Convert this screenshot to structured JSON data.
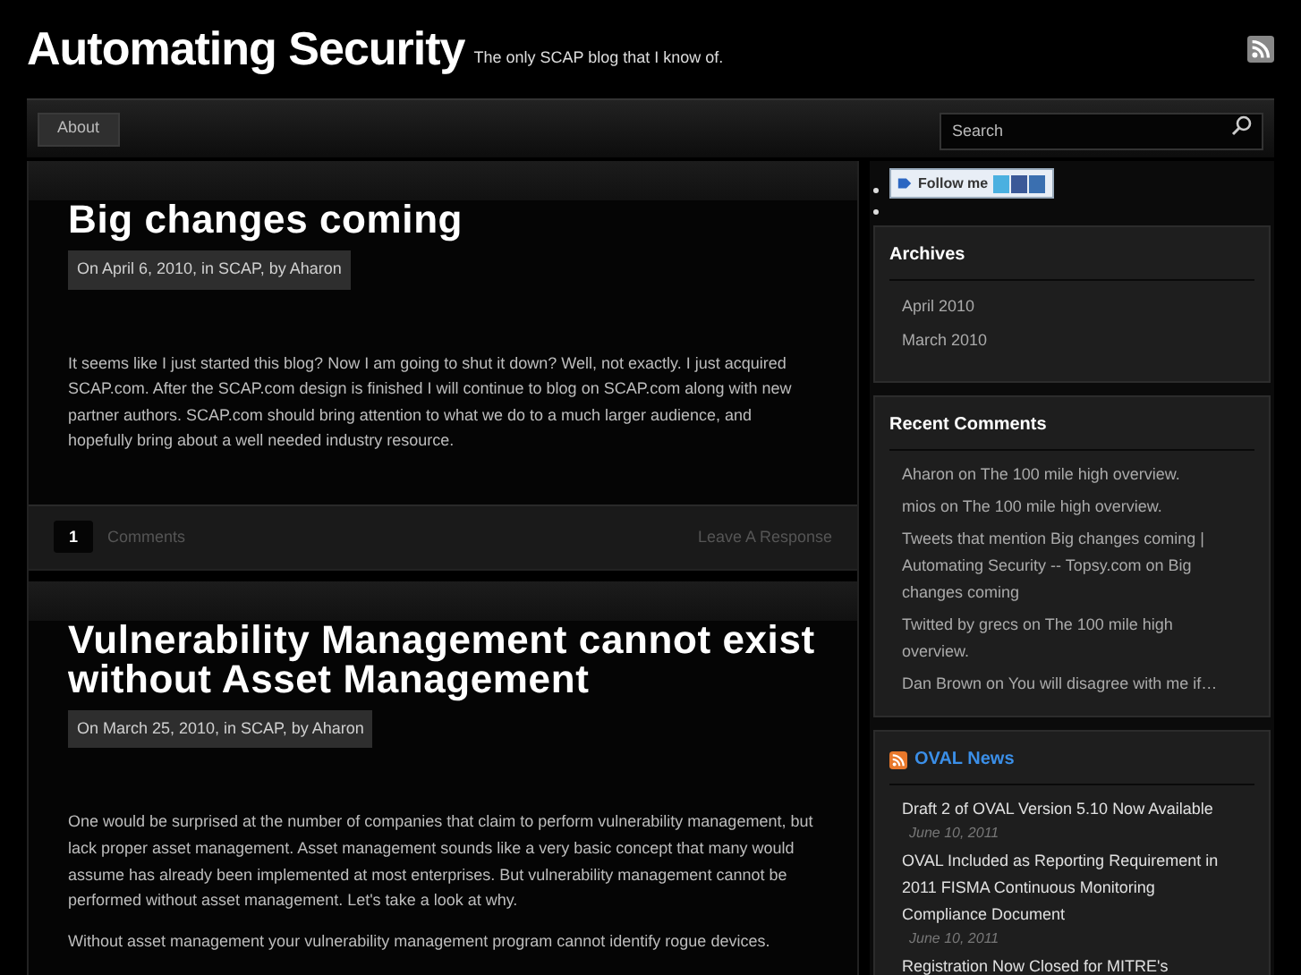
{
  "header": {
    "title": "Automating Security",
    "tagline": "The only SCAP blog that I know of."
  },
  "nav": {
    "items": [
      {
        "label": "About",
        "selected": false
      }
    ],
    "search": {
      "placeholder": "Search"
    }
  },
  "posts": [
    {
      "title": "Big changes coming",
      "meta": "On April 6, 2010, in SCAP, by Aharon",
      "paragraphs": [
        "It seems like I just started this blog? Now I am going to shut it down? Well, not exactly. I just acquired SCAP.com. After the SCAP.com design is finished I will continue to blog on SCAP.com along with new partner authors. SCAP.com should bring attention to what we do to a much larger audience, and hopefully bring about a well needed industry resource."
      ],
      "comment_count": "1",
      "comments_label": "Comments",
      "response_link": "Leave A Response"
    },
    {
      "title": "Vulnerability Management cannot exist without Asset Management",
      "meta": "On March 25, 2010, in SCAP, by Aharon",
      "paragraphs": [
        "One would be surprised at the number of companies that claim to perform vulnerability management, but lack proper asset management. Asset management sounds like a very basic concept that many would assume has already been implemented at most enterprises. But vulnerability management cannot be performed without asset management. Let's take a look at why.",
        "Without asset management your vulnerability management program cannot identify rogue devices."
      ]
    }
  ],
  "sidebar": {
    "follow_badge": "Follow me",
    "archives": {
      "title": "Archives",
      "items": [
        "April 2010",
        "March 2010"
      ]
    },
    "recent_comments": {
      "title": "Recent Comments",
      "items": [
        "Aharon on The 100 mile high overview.",
        "mios on The 100 mile high overview.",
        "Tweets that mention Big changes coming | Automating Security -- Topsy.com on Big changes coming",
        "Twitted by grecs on The 100 mile high overview.",
        "Dan Brown on You will disagree with me if…"
      ]
    },
    "oval_news": {
      "title": "OVAL News",
      "items": [
        {
          "title": "Draft 2 of OVAL Version 5.10 Now Available",
          "date": "June 10, 2011"
        },
        {
          "title": "OVAL Included as Reporting Requirement in 2011 FISMA Continuous Monitoring Compliance Document",
          "date": "June 10, 2011"
        },
        {
          "title": "Registration Now Closed for MITRE's"
        }
      ]
    }
  }
}
